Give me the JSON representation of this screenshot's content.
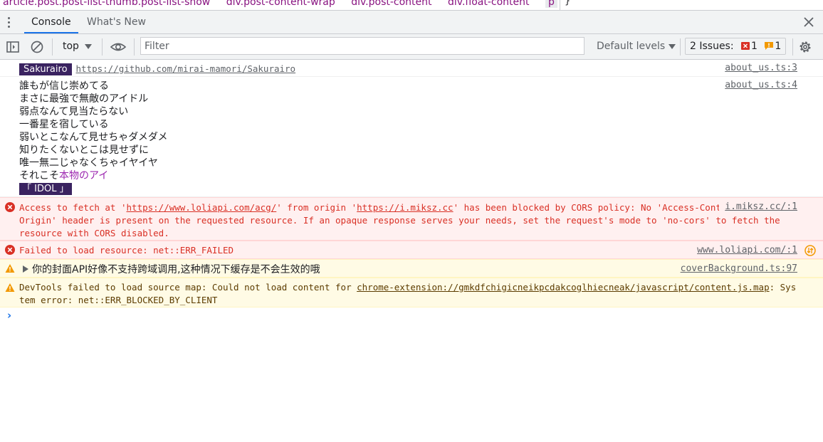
{
  "crumbs": {
    "items": [
      "article.post.post-list-thumb.post-list-show",
      "div.post-content-wrap",
      "div.post-content",
      "div.float-content",
      "p"
    ],
    "brace": "}"
  },
  "tabs": [
    {
      "label": "Console",
      "active": true
    },
    {
      "label": "What's New",
      "active": false
    }
  ],
  "toolbar": {
    "context": "top",
    "filter_placeholder": "Filter",
    "levels": "Default levels",
    "issues_label": "2 Issues:",
    "issues_errors": "1",
    "issues_warnings": "1"
  },
  "messages": {
    "m1": {
      "badge": "Sakurairo",
      "url": "https://github.com/mirai-mamori/Sakurairo",
      "source": "about_us.ts:3"
    },
    "m2": {
      "lines": [
        "誰もが信じ崇めてる",
        "まさに最強で無敵のアイドル",
        "弱点なんて見当たらない",
        "一番星を宿している",
        "弱いとこなんて見せちゃダメダメ",
        "知りたくないとこは見せずに",
        "唯一無二じゃなくちゃイヤイヤ"
      ],
      "last_prefix": "それこそ",
      "last_highlight": "本物のアイ",
      "idol": "「 IDOL 」",
      "source": "about_us.ts:4"
    },
    "m3": {
      "p1": "Access to fetch at '",
      "url1": "https://www.loliapi.com/acg/",
      "p2": "' from origin '",
      "url2": "https://i.miksz.cc",
      "p3": "' has been blocked by CORS policy: No 'Access-Control-Allow-Origin' header is present on the requested resource. If an opaque response serves your needs, set the request's mode to 'no-cors' to fetch the resource with CORS disabled.",
      "source": "i.miksz.cc/:1"
    },
    "m4": {
      "text": "Failed to load resource: net::ERR_FAILED",
      "source": "www.loliapi.com/:1"
    },
    "m5": {
      "text": "你的封面API好像不支持跨域调用,这种情况下缓存是不会生效的哦",
      "source": "coverBackground.ts:97"
    },
    "m6": {
      "p1": "DevTools failed to load source map: Could not load content for ",
      "url": "chrome-extension://gmkdfchigicneikpcdakcoglhiecneak/javascript/content.js.map",
      "p2": ": System error: net::ERR_BLOCKED_BY_CLIENT"
    }
  },
  "prompt": "›",
  "colors": {
    "error": "#d93025",
    "warning": "#f29900",
    "accent": "#1a73e8",
    "badge_bg": "#3a2360",
    "highlight": "#9c27b0"
  }
}
